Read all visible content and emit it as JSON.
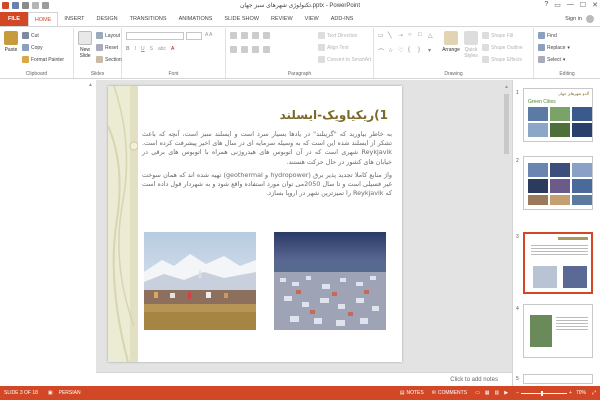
{
  "window": {
    "title": "تکنولوژی شهرهای سبز جهان.pptx - PowerPoint",
    "controls": [
      "?",
      "▭",
      "—",
      "☐",
      "✕"
    ]
  },
  "tabs": [
    "FILE",
    "HOME",
    "INSERT",
    "DESIGN",
    "TRANSITIONS",
    "ANIMATIONS",
    "SLIDE SHOW",
    "REVIEW",
    "VIEW",
    "ADD-INS"
  ],
  "active_tab": "HOME",
  "signin": "Sign in",
  "ribbon": {
    "clipboard": {
      "label": "Clipboard",
      "paste": "Paste",
      "cut": "Cut",
      "copy": "Copy",
      "format_painter": "Format Painter"
    },
    "slides": {
      "label": "Slides",
      "new_slide": "New Slide",
      "layout": "Layout",
      "reset": "Reset",
      "section": "Section"
    },
    "font": {
      "label": "Font"
    },
    "paragraph": {
      "label": "Paragraph",
      "text_direction": "Text Direction",
      "align_text": "Align Text",
      "convert": "Convert to SmartArt"
    },
    "drawing": {
      "label": "Drawing",
      "arrange": "Arrange",
      "quick_styles": "Quick Styles",
      "shape_fill": "Shape Fill",
      "shape_outline": "Shape Outline",
      "shape_effects": "Shape Effects"
    },
    "editing": {
      "label": "Editing",
      "find": "Find",
      "replace": "Replace",
      "select": "Select"
    }
  },
  "slide": {
    "title": "1)ریکیاویک-ایسلند",
    "para1": "به خاطر بیاورید که \"گرینلند\" در یادها بسیار سرد است و ایسلند سبز است، آنچه که باعث تشکر از ایسلند شده این است که به وسیله سرمایه ای در سال های اخیر پیشرفت کرده است. Reykjavik شهری است که در آن اتوبوس های هیدروژنی همراه با اتوبوس های برقی در خیابان های کشور در حال حرکت هستند.",
    "para2": "واژ منابع کاملا تجدید پذیر برق (hydropower و geothermal) تهیه شده اند که همان سوخت غیر فسیلی است و تا سال 2050می توان مورد استفاده واقع شود و به شهردار قول داده است که Reykjavik را تمیزترین شهر در اروپا بسازد."
  },
  "notes_placeholder": "Click to add notes",
  "thumbnails": [
    {
      "num": "1",
      "heading": "آلدو شهرهای جهان",
      "sub": "Green Cities"
    },
    {
      "num": "2"
    },
    {
      "num": "3",
      "selected": true
    },
    {
      "num": "4"
    },
    {
      "num": "5"
    }
  ],
  "status": {
    "slide_of": "SLIDE 3 OF 18",
    "language": "PERSIAN",
    "notes": "NOTES",
    "comments": "COMMENTS",
    "zoom": "70%"
  },
  "colors": {
    "accent": "#d24726",
    "slide_bg": "#ffffff",
    "title_color": "#7a6a2a"
  }
}
